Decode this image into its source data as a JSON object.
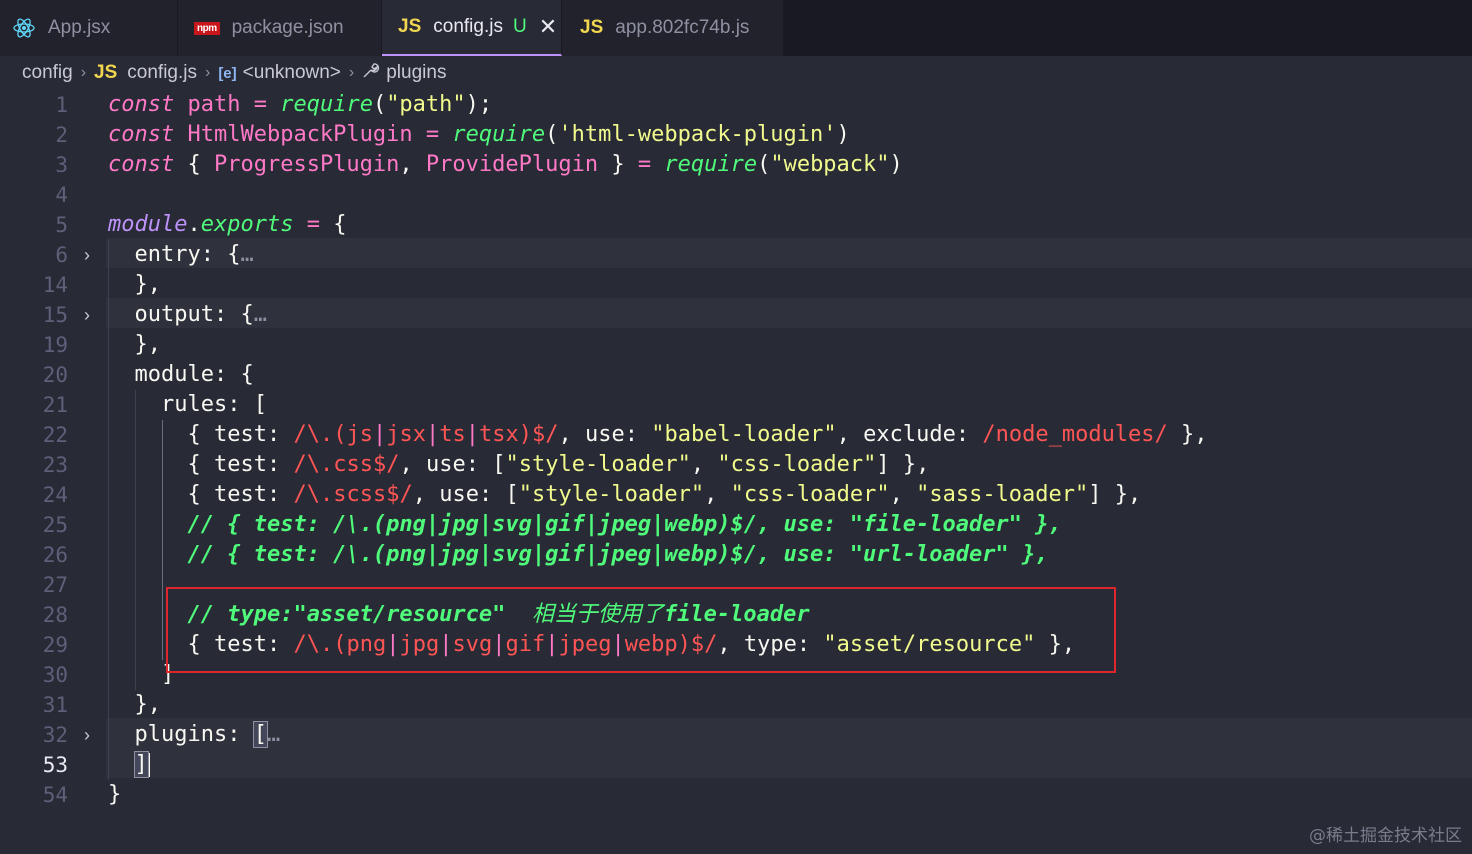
{
  "tabs": [
    {
      "label": "App.jsx",
      "icon": "react-icon"
    },
    {
      "label": "package.json",
      "icon": "npm-icon",
      "icon_text": "npm"
    },
    {
      "label": "config.js",
      "icon": "js-icon",
      "icon_text": "JS",
      "modified": "U",
      "close": "✕",
      "active": true
    },
    {
      "label": "app.802fc74b.js",
      "icon": "js-icon",
      "icon_text": "JS"
    }
  ],
  "breadcrumb": {
    "folder": "config",
    "file_icon": "JS",
    "file": "config.js",
    "symbol_icon": "[e]",
    "symbol": "<unknown>",
    "leaf": "plugins",
    "separator": "›"
  },
  "gutter": [
    "1",
    "2",
    "3",
    "4",
    "5",
    "6",
    "14",
    "15",
    "19",
    "20",
    "21",
    "22",
    "23",
    "24",
    "25",
    "26",
    "27",
    "28",
    "29",
    "30",
    "31",
    "32",
    "53",
    "54"
  ],
  "code": {
    "l1": {
      "kw": "const",
      "name": "path",
      "eq": "=",
      "fn": "require",
      "open": "(",
      "arg": "\"path\"",
      "close": ");"
    },
    "l2": {
      "kw": "const",
      "name": "HtmlWebpackPlugin",
      "eq": "=",
      "fn": "require",
      "open": "(",
      "arg": "'html-webpack-plugin'",
      "close": ")"
    },
    "l3": {
      "kw": "const",
      "open": "{ ",
      "a": "ProgressPlugin",
      "comma": ", ",
      "b": "ProvidePlugin",
      "close": " }",
      "eq": "=",
      "fn": "require",
      "p1": "(",
      "arg": "\"webpack\"",
      "p2": ")"
    },
    "l5": {
      "mod": "module",
      "dot": ".",
      "prop": "exports",
      "eq": "=",
      "brace": "{"
    },
    "l6": {
      "key": "entry",
      "colon": ":",
      "brace": "{",
      "ellipsis": "…"
    },
    "l14": {
      "text": "},"
    },
    "l15": {
      "key": "output",
      "colon": ":",
      "brace": "{",
      "ellipsis": "…"
    },
    "l19": {
      "text": "},"
    },
    "l20": {
      "key": "module",
      "colon": ":",
      "brace": "{"
    },
    "l21": {
      "key": "rules",
      "colon": ":",
      "bracket": "["
    },
    "l22": {
      "open": "{ ",
      "test": "test",
      "colon": ": ",
      "rx1": "/\\.",
      "rx2": "(js",
      "p1": "|",
      "rx3": "jsx",
      "p2": "|",
      "rx4": "ts",
      "p3": "|",
      "rx5": "tsx)",
      "rx6": "$/",
      "c1": ", ",
      "use": "use",
      "colon2": ": ",
      "val": "\"babel-loader\"",
      "c2": ", ",
      "exclude": "exclude",
      "colon3": ": ",
      "rx7": "/node_modules/",
      "close": " },"
    },
    "l23": {
      "open": "{ ",
      "test": "test",
      "colon": ": ",
      "rx1": "/\\.",
      "rx2": "css",
      "rx6": "$/",
      "c1": ", ",
      "use": "use",
      "colon2": ": ",
      "arr": "[",
      "v1": "\"style-loader\"",
      "c2": ", ",
      "v2": "\"css-loader\"",
      "arrc": "]",
      "close": " },"
    },
    "l24": {
      "open": "{ ",
      "test": "test",
      "colon": ": ",
      "rx1": "/\\.",
      "rx2": "scss",
      "rx6": "$/",
      "c1": ", ",
      "use": "use",
      "colon2": ": ",
      "arr": "[",
      "v1": "\"style-loader\"",
      "c2": ", ",
      "v2": "\"css-loader\"",
      "c3": ", ",
      "v3": "\"sass-loader\"",
      "arrc": "]",
      "close": " },"
    },
    "l25": {
      "text": "// { test: /\\.(png|jpg|svg|gif|jpeg|webp)$/, use: \"file-loader\" },"
    },
    "l26": {
      "text": "// { test: /\\.(png|jpg|svg|gif|jpeg|webp)$/, use: \"url-loader\" },"
    },
    "l28": {
      "text": "// type:\"asset/resource\"  ",
      "cn": "相当于使用了",
      "tail": "file-loader"
    },
    "l29": {
      "open": "{ ",
      "test": "test",
      "colon": ": ",
      "rx1": "/\\.",
      "rx2": "(png",
      "p1": "|",
      "rx3": "jpg",
      "p2": "|",
      "rx4": "svg",
      "p3": "|",
      "rx5": "gif",
      "p4": "|",
      "rx5b": "jpeg",
      "p5": "|",
      "rx5c": "webp)",
      "rx6": "$/",
      "c1": ", ",
      "type": "type",
      "colon2": ": ",
      "val": "\"asset/resource\"",
      "close": " },"
    },
    "l30": {
      "text": "]"
    },
    "l31": {
      "text": "},"
    },
    "l32": {
      "key": "plugins",
      "colon": ":",
      "bracket": "[",
      "ellipsis": "…"
    },
    "l53": {
      "text": "]"
    },
    "l54": {
      "text": "}"
    }
  },
  "watermark": "@稀土掘金技术社区",
  "colors": {
    "accent": "#bd93f9",
    "highlight_box": "#e0262d",
    "background": "#282a36"
  }
}
